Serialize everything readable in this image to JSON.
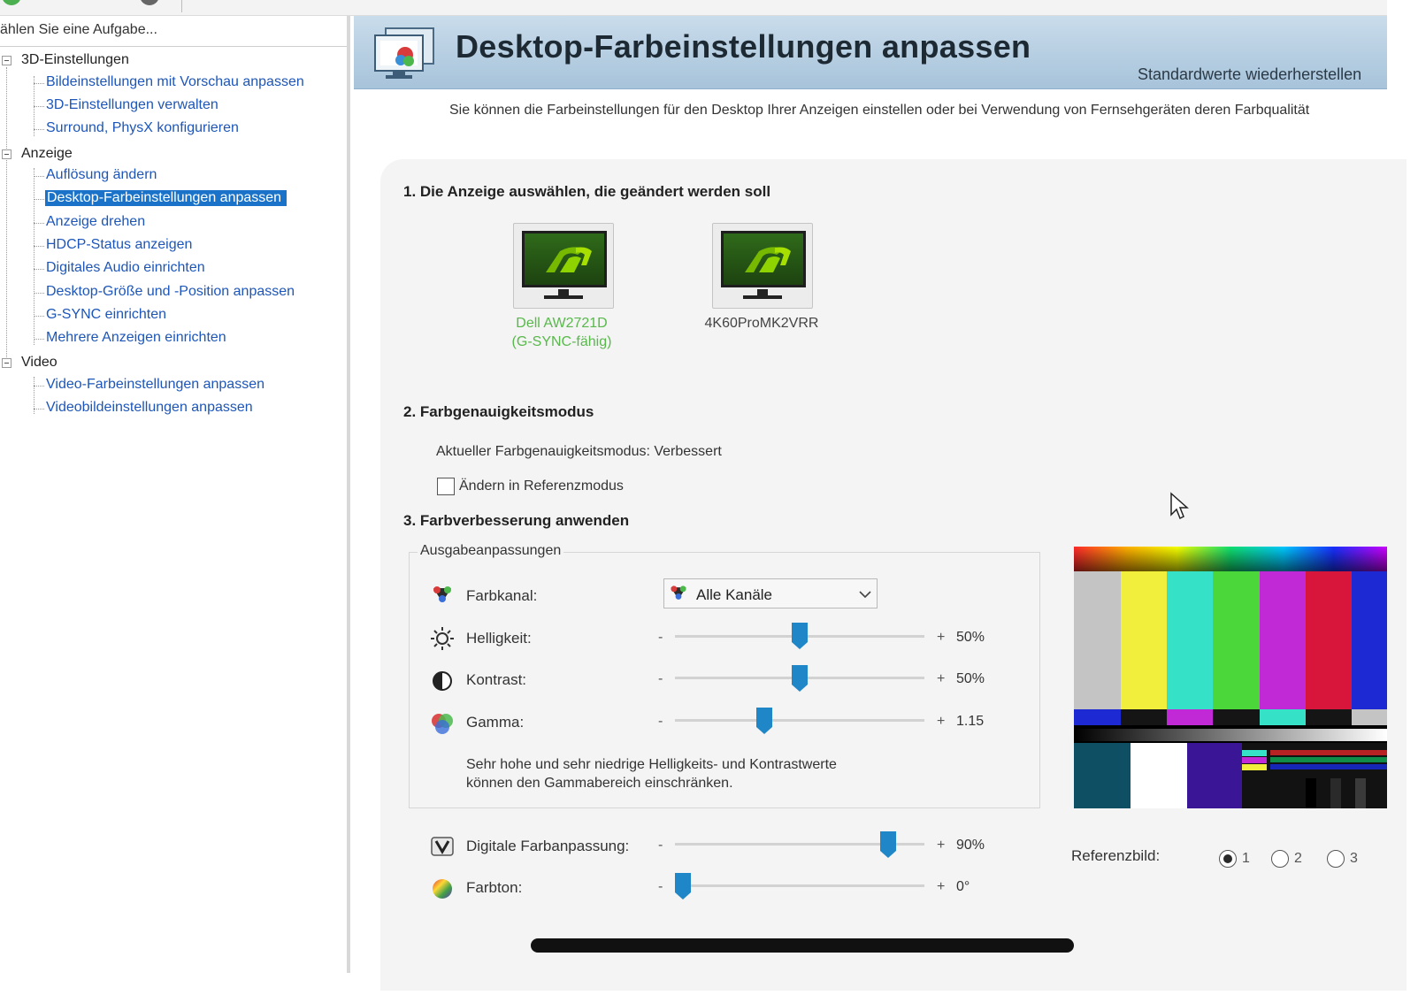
{
  "colors": {
    "accent": "#1a73c8",
    "link": "#1d56b8",
    "nvidia_green": "#76b900",
    "label_green": "#59b84c",
    "slider_thumb": "#1f86c7"
  },
  "left": {
    "hint": "ählen Sie eine Aufgabe...",
    "tree": [
      {
        "label": "3D-Einstellungen",
        "children": [
          "Bildeinstellungen mit Vorschau anpassen",
          "3D-Einstellungen verwalten",
          "Surround, PhysX konfigurieren"
        ]
      },
      {
        "label": "Anzeige",
        "children": [
          "Auflösung ändern",
          "Desktop-Farbeinstellungen anpassen",
          "Anzeige drehen",
          "HDCP-Status anzeigen",
          "Digitales Audio einrichten",
          "Desktop-Größe und -Position anpassen",
          "G-SYNC einrichten",
          "Mehrere Anzeigen einrichten"
        ]
      },
      {
        "label": "Video",
        "children": [
          "Video-Farbeinstellungen anpassen",
          "Videobildeinstellungen anpassen"
        ]
      }
    ],
    "selected": "Desktop-Farbeinstellungen anpassen"
  },
  "header": {
    "title": "Desktop-Farbeinstellungen anpassen",
    "restore": "Standardwerte wiederherstellen",
    "description": "Sie können die Farbeinstellungen für den Desktop Ihrer Anzeigen einstellen oder bei Verwendung von Fernsehgeräten deren Farbqualität"
  },
  "section1": {
    "title": "1. Die Anzeige auswählen, die geändert werden soll",
    "displays": [
      {
        "line1": "Dell AW2721D",
        "line2": "(G-SYNC-fähig)",
        "selected": true
      },
      {
        "line1": "4K60ProMK2VRR",
        "line2": "",
        "selected": false
      }
    ]
  },
  "section2": {
    "title": "2. Farbgenauigkeitsmodus",
    "current": "Aktueller Farbgenauigkeitsmodus: Verbessert",
    "checkbox_label": "Ändern in Referenzmodus",
    "checked": false
  },
  "section3": {
    "title": "3. Farbverbesserung anwenden",
    "group_title": "Ausgabeanpassungen",
    "channel_label": "Farbkanal:",
    "channel_value": "Alle Kanäle",
    "sliders": [
      {
        "label": "Helligkeit:",
        "value": "50%",
        "level": 0.5,
        "icon": "sun-icon"
      },
      {
        "label": "Kontrast:",
        "value": "50%",
        "level": 0.5,
        "icon": "contrast-icon"
      },
      {
        "label": "Gamma:",
        "value": "1.15",
        "level": 0.35,
        "icon": "gamma-icon"
      }
    ],
    "warning_line1": "Sehr hohe und sehr niedrige Helligkeits- und Kontrastwerte",
    "warning_line2": "können den Gammabereich einschränken.",
    "extra_sliders": [
      {
        "label": "Digitale Farbanpassung:",
        "value": "90%",
        "level": 0.88,
        "icon": "vibrance-icon"
      },
      {
        "label": "Farbton:",
        "value": "0°",
        "level": 0.0,
        "icon": "hue-icon"
      }
    ],
    "minus": "-",
    "plus": "+"
  },
  "reference": {
    "label": "Referenzbild:",
    "options": [
      "1",
      "2",
      "3"
    ],
    "selected": "1"
  }
}
